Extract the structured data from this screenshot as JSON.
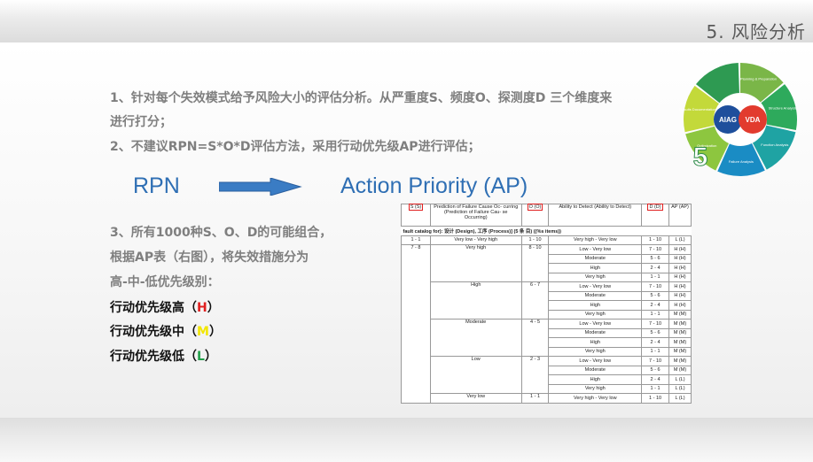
{
  "slide": {
    "title": "5. 风险分析"
  },
  "intro": {
    "line1": "1、针对每个失效模式给予风险大小的评估分析。从严重度S、频度O、探测度D 三个维度来",
    "line2": "进行打分；",
    "line3": "2、不建议RPN=S*O*D评估方法，采用行动优先级AP进行评估；"
  },
  "compare": {
    "from": "RPN",
    "to": "Action Priority (AP)"
  },
  "combo": {
    "line1": "3、所有1000种S、O、D的可能组合，",
    "line2": "根据AP表（右图），将失效措施分为",
    "line3": "高-中-低优先级别："
  },
  "priorities": [
    {
      "prefix": "行动优先级高（",
      "code": "H",
      "suffix": "）",
      "color": "#e02020"
    },
    {
      "prefix": "行动优先级中（",
      "code": "M",
      "suffix": "）",
      "color": "#f2e600"
    },
    {
      "prefix": "行动优先级低（",
      "code": "L",
      "suffix": "）",
      "color": "#22a04a"
    }
  ],
  "logo": {
    "center_left": "AIAG",
    "center_right": "VDA",
    "number": "5",
    "segments": [
      {
        "label": "Planning & Preparation",
        "color": "#7ab648"
      },
      {
        "label": "Structure Analysis",
        "color": "#2eaa5c"
      },
      {
        "label": "Function Analysis",
        "color": "#1fa3a3"
      },
      {
        "label": "Failure Analysis",
        "color": "#1a8cc4"
      },
      {
        "label": "Optimization",
        "color": "#8dc63f"
      },
      {
        "label": "Results Documentation",
        "color": "#c3d93a"
      }
    ]
  },
  "ap_table": {
    "headers": {
      "s": "S (S)",
      "prediction": "Prediction of Failure Cause Oc- curring (Prediction of Failure Cau- se Occurring)",
      "o": "O (O)",
      "ability": "Ability to Detect (Ability to Detect)",
      "d": "D (D)",
      "ap": "AP (AP)"
    },
    "catalog": "fault catalog for): 设计 (Design), 工序 (Process)] (5 条 目) ((%s items))",
    "row_first": {
      "s": "1 - 1",
      "pred": "Very low - Very high",
      "o": "1 - 10",
      "det": "Very high - Very low",
      "d": "1 - 10",
      "ap": "L (L)"
    },
    "s_group": "7 - 8",
    "o_groups": [
      {
        "pred": "Very high",
        "o": "8 - 10",
        "rows": [
          {
            "det": "Low - Very low",
            "d": "7 - 10",
            "ap": "H (H)"
          },
          {
            "det": "Moderate",
            "d": "5 - 6",
            "ap": "H (H)"
          },
          {
            "det": "High",
            "d": "2 - 4",
            "ap": "H (H)"
          },
          {
            "det": "Very high",
            "d": "1 - 1",
            "ap": "H (H)"
          }
        ]
      },
      {
        "pred": "High",
        "o": "6 - 7",
        "rows": [
          {
            "det": "Low - Very low",
            "d": "7 - 10",
            "ap": "H (H)"
          },
          {
            "det": "Moderate",
            "d": "5 - 6",
            "ap": "H (H)"
          },
          {
            "det": "High",
            "d": "2 - 4",
            "ap": "H (H)"
          },
          {
            "det": "Very high",
            "d": "1 - 1",
            "ap": "M (M)"
          }
        ]
      },
      {
        "pred": "Moderate",
        "o": "4 - 5",
        "rows": [
          {
            "det": "Low - Very low",
            "d": "7 - 10",
            "ap": "M (M)"
          },
          {
            "det": "Moderate",
            "d": "5 - 6",
            "ap": "M (M)"
          },
          {
            "det": "High",
            "d": "2 - 4",
            "ap": "M (M)"
          },
          {
            "det": "Very high",
            "d": "1 - 1",
            "ap": "M (M)"
          }
        ]
      },
      {
        "pred": "Low",
        "o": "2 - 3",
        "rows": [
          {
            "det": "Low - Very low",
            "d": "7 - 10",
            "ap": "M (M)"
          },
          {
            "det": "Moderate",
            "d": "5 - 6",
            "ap": "M (M)"
          },
          {
            "det": "High",
            "d": "2 - 4",
            "ap": "L (L)"
          },
          {
            "det": "Very high",
            "d": "1 - 1",
            "ap": "L (L)"
          }
        ]
      },
      {
        "pred": "Very low",
        "o": "1 - 1",
        "rows": [
          {
            "det": "Very high - Very low",
            "d": "1 - 10",
            "ap": "L (L)"
          }
        ]
      }
    ]
  }
}
